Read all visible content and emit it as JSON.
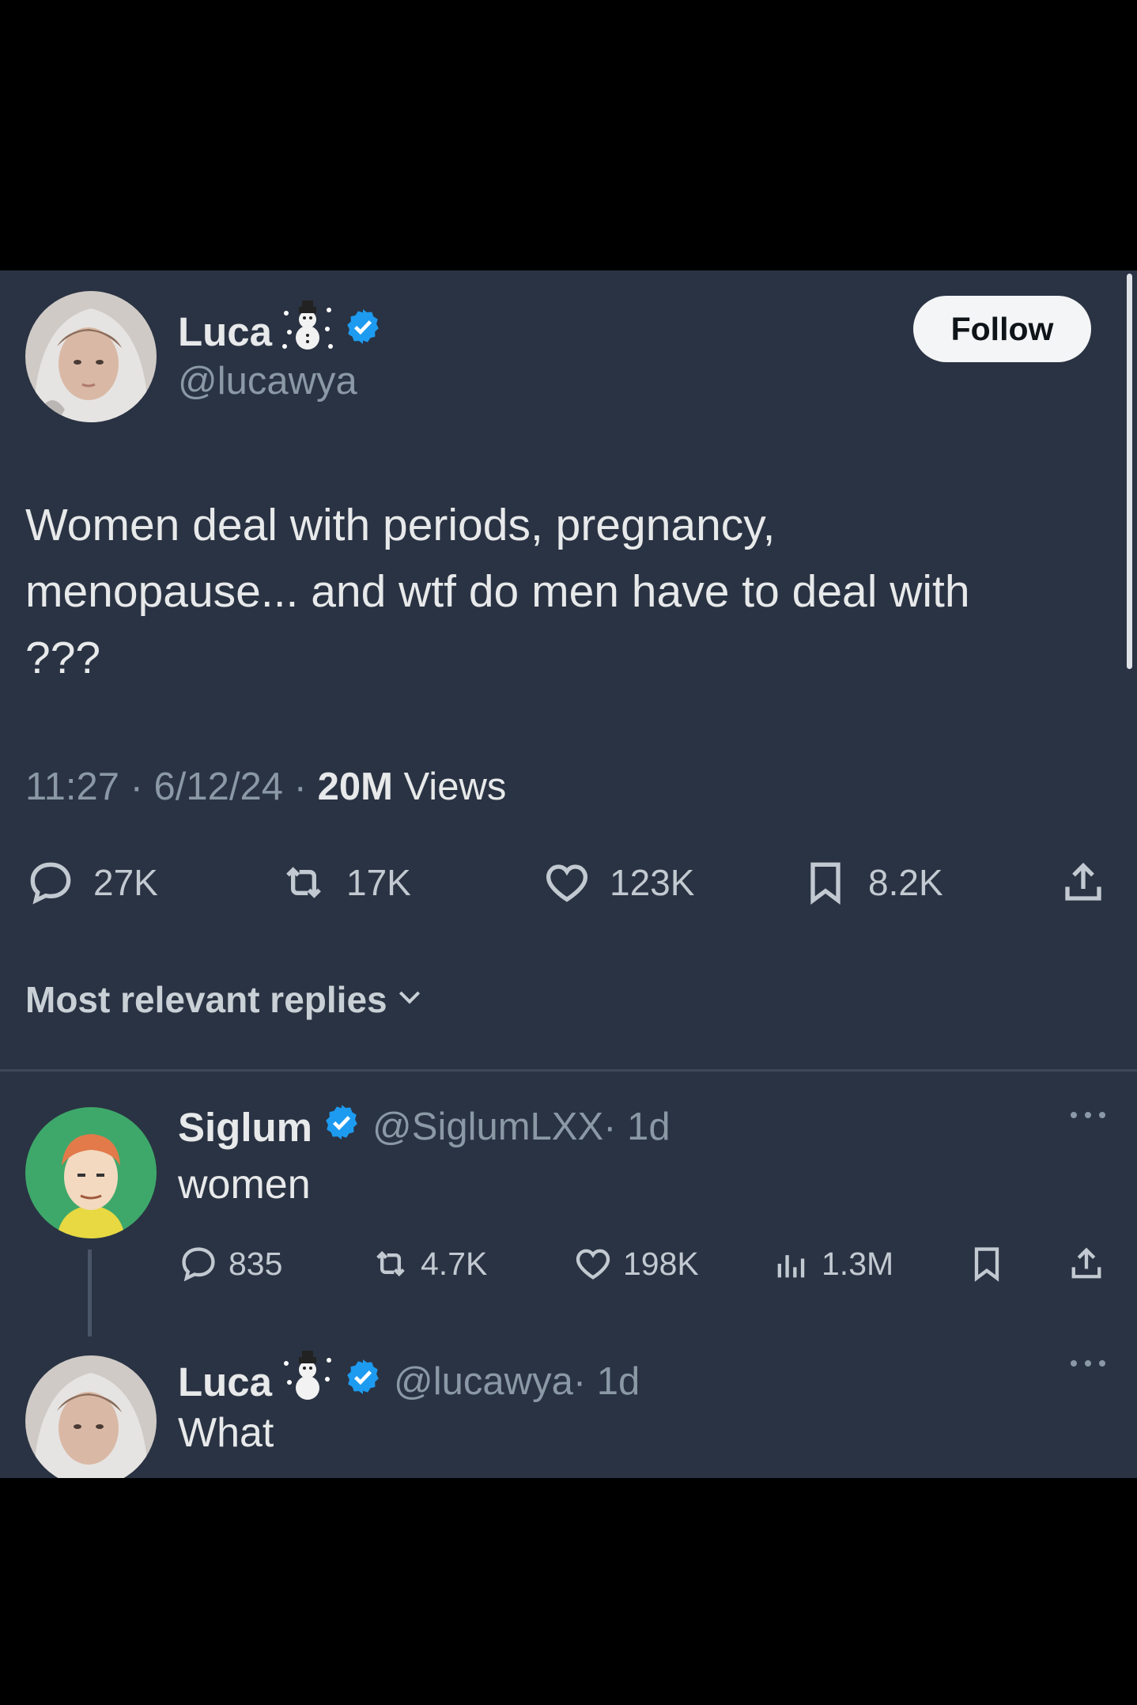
{
  "tweet": {
    "author_name": "Luca",
    "author_handle": "@lucawya",
    "follow_label": "Follow",
    "text": "Women deal with periods, pregnancy, menopause... and wtf do men have to deal with ???",
    "time": "11:27 · 6/12/24 · ",
    "views_count": "20M",
    "views_label": " Views",
    "replies": "27K",
    "reposts": "17K",
    "likes": "123K",
    "bookmarks": "8.2K"
  },
  "replies_sort_label": "Most relevant replies",
  "reply1": {
    "author_name": "Siglum",
    "author_handle": "@SiglumLXX",
    "age": " · 1d",
    "text": "women",
    "replies": "835",
    "reposts": "4.7K",
    "likes": "198K",
    "views": "1.3M"
  },
  "reply2": {
    "author_name": "Luca",
    "author_handle": "@lucawya",
    "age": " · 1d",
    "text": "What"
  },
  "colors": {
    "background": "#2a3343",
    "verified": "#1d9bf0",
    "text_primary": "#e7e9ea",
    "text_secondary": "#8b98a5"
  },
  "icons": [
    "snowman-emoji-icon",
    "verified-badge-icon",
    "reply-icon",
    "repost-icon",
    "like-icon",
    "bookmark-icon",
    "share-icon",
    "views-icon",
    "more-icon",
    "chevron-down-icon"
  ]
}
